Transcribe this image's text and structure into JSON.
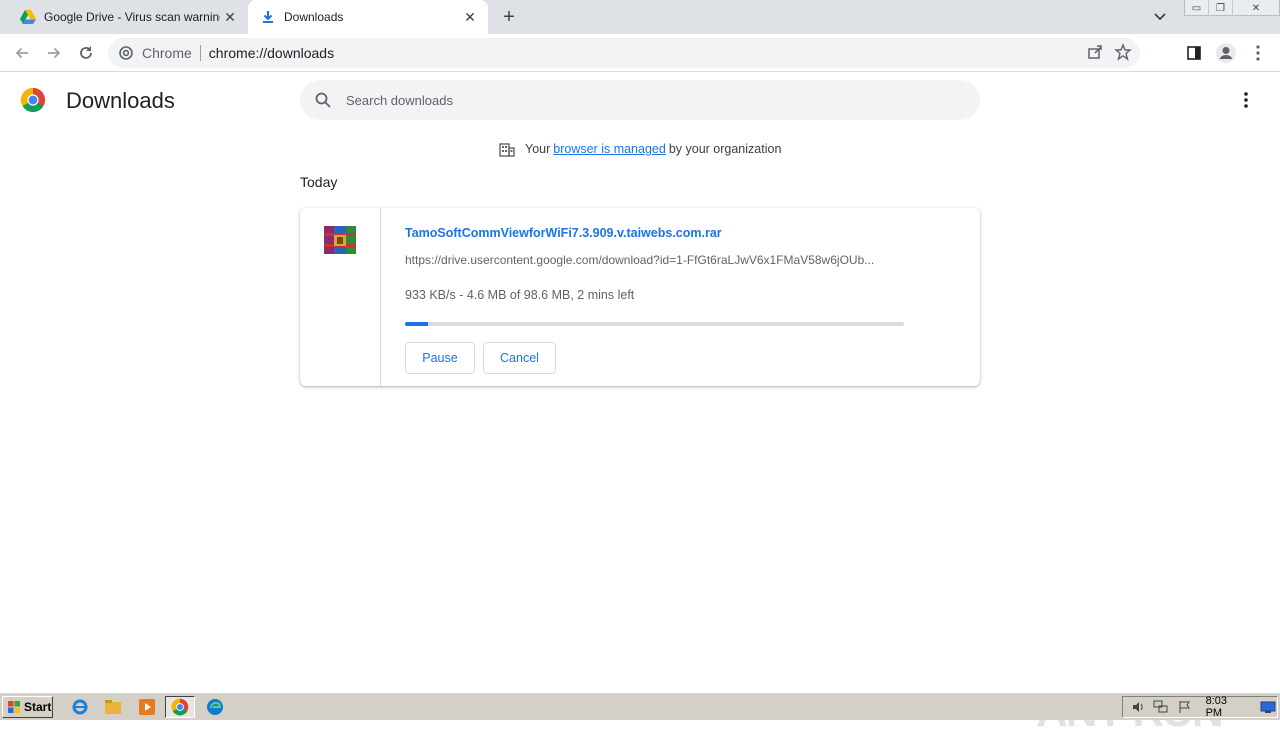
{
  "tabs": [
    {
      "title": "Google Drive - Virus scan warning",
      "active": false
    },
    {
      "title": "Downloads",
      "active": true
    }
  ],
  "omnibox": {
    "chip": "Chrome",
    "url": "chrome://downloads"
  },
  "page": {
    "title": "Downloads",
    "search_placeholder": "Search downloads",
    "managed": {
      "prefix": "Your",
      "link": "browser is managed",
      "suffix": "by your organization"
    },
    "section": "Today"
  },
  "download": {
    "filename": "TamoSoftCommViewforWiFi7.3.909.v.taiwebs.com.rar",
    "url": "https://drive.usercontent.google.com/download?id=1-FfGt6raLJwV6x1FMaV58w6jOUb...",
    "status": "933 KB/s - 4.6 MB of 98.6 MB, 2 mins left",
    "progress_fraction": 0.0467,
    "pause_label": "Pause",
    "cancel_label": "Cancel"
  },
  "watermark": "ANY RUN",
  "taskbar": {
    "start_label": "Start",
    "clock": "8:03 PM"
  },
  "colors": {
    "accent": "#1a73e8",
    "tabstrip": "#dee1e6",
    "taskbar": "#d4d0c8"
  }
}
